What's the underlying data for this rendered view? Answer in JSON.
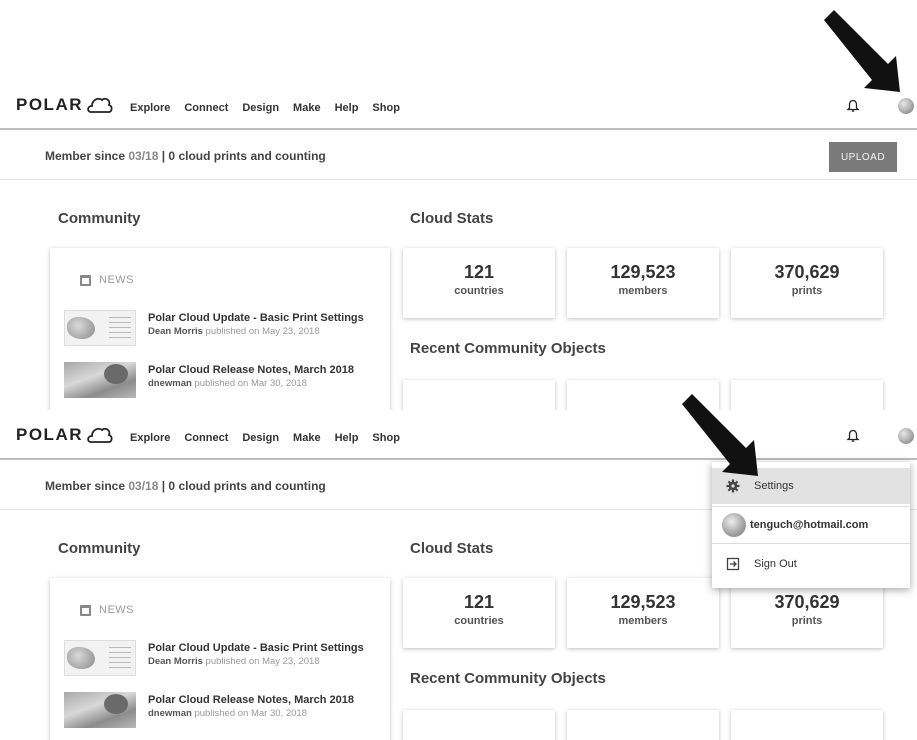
{
  "panels": [
    {
      "brand": {
        "logo_text": "POLAR"
      },
      "nav": [
        "Explore",
        "Connect",
        "Design",
        "Make",
        "Help",
        "Shop"
      ],
      "member": {
        "prefix": "Member since ",
        "date": "03/18",
        "suffix": " | 0 cloud prints and counting"
      },
      "upload_label": "UPLOAD",
      "community_title": "Community",
      "news": {
        "header": "NEWS",
        "items": [
          {
            "title": "Polar Cloud Update - Basic Print Settings",
            "author": "Dean Morris",
            "published": " published on May 23, 2018"
          },
          {
            "title": "Polar Cloud Release Notes, March 2018",
            "author": "dnewman",
            "published": " published on Mar 30, 2018"
          }
        ]
      },
      "cloud_stats_title": "Cloud Stats",
      "stats": [
        {
          "value": "121",
          "label": "countries"
        },
        {
          "value": "129,523",
          "label": "members"
        },
        {
          "value": "370,629",
          "label": "prints"
        }
      ],
      "recent_title": "Recent Community Objects"
    },
    {
      "brand": {
        "logo_text": "POLAR"
      },
      "nav": [
        "Explore",
        "Connect",
        "Design",
        "Make",
        "Help",
        "Shop"
      ],
      "member": {
        "prefix": "Member since ",
        "date": "03/18",
        "suffix": " | 0 cloud prints and counting"
      },
      "community_title": "Community",
      "news": {
        "header": "NEWS",
        "items": [
          {
            "title": "Polar Cloud Update - Basic Print Settings",
            "author": "Dean Morris",
            "published": " published on May 23, 2018"
          },
          {
            "title": "Polar Cloud Release Notes, March 2018",
            "author": "dnewman",
            "published": " published on Mar 30, 2018"
          }
        ]
      },
      "cloud_stats_title": "Cloud Stats",
      "stats": [
        {
          "value": "121",
          "label": "countries"
        },
        {
          "value": "129,523",
          "label": "members"
        },
        {
          "value": "370,629",
          "label": "prints"
        }
      ],
      "recent_title": "Recent Community Objects",
      "dropdown": {
        "settings": "Settings",
        "email": "tenguch@hotmail.com",
        "sign_out": "Sign Out"
      }
    }
  ],
  "icons": {
    "bell": "bell-icon",
    "avatar": "globe-avatar-icon",
    "news": "calendar-icon",
    "settings": "gear-icon",
    "sign_out": "sign-out-icon",
    "pointer": "arrow-pointer-icon"
  },
  "colors": {
    "upload_button": "#7a7a7a",
    "divider": "#bdbdbd",
    "arrow": "#111111",
    "dropdown_highlight": "#e2e2e2"
  }
}
